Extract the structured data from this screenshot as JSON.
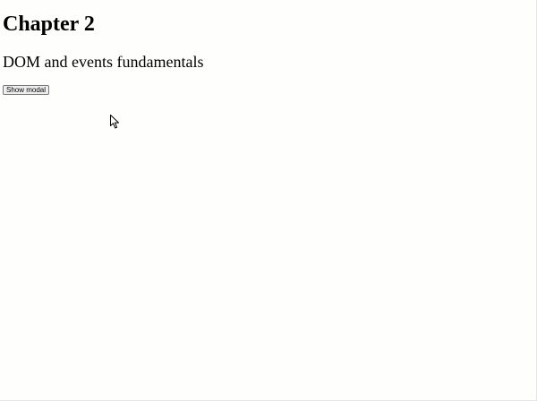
{
  "page": {
    "title": "Chapter 2",
    "subtitle": "DOM and events fundamentals"
  },
  "actions": {
    "show_modal_label": "Show modal"
  },
  "cursor": {
    "icon": "arrow-cursor-icon"
  }
}
